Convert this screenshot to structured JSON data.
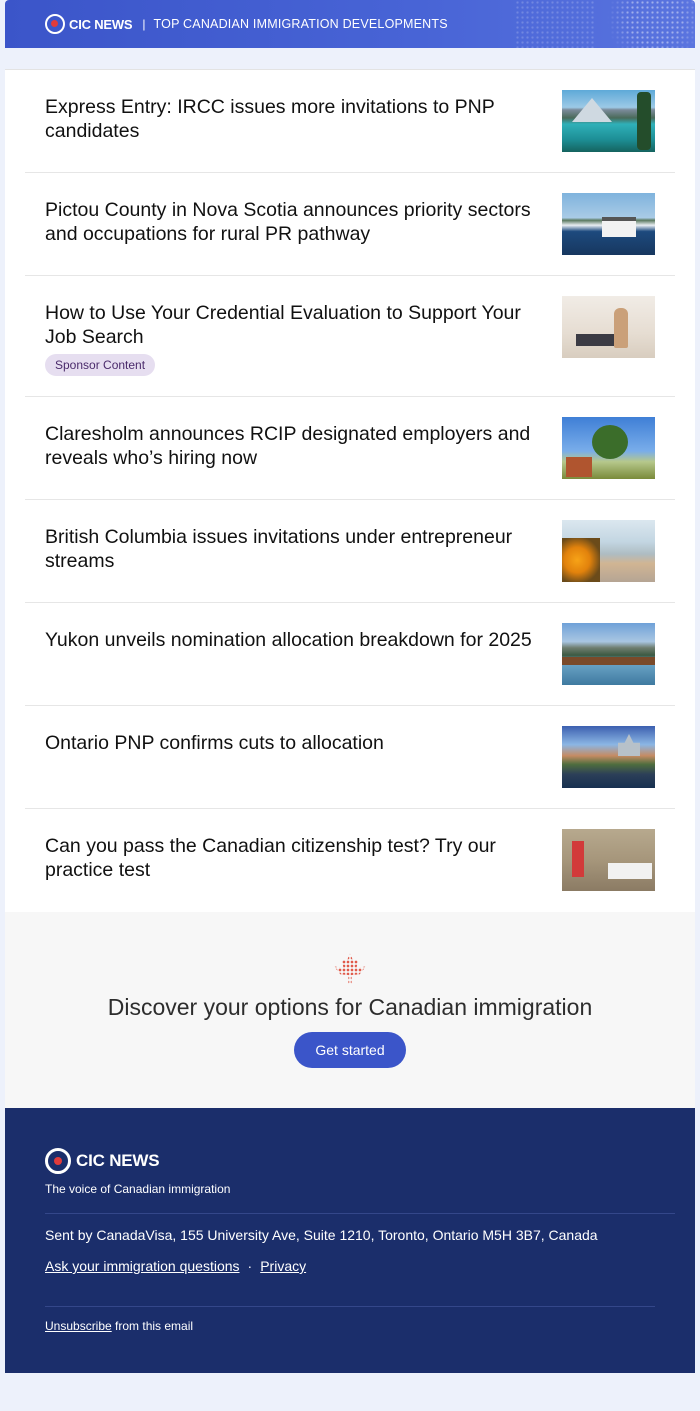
{
  "header": {
    "brand": "CIC NEWS",
    "separator": "|",
    "tagline": "TOP CANADIAN IMMIGRATION DEVELOPMENTS"
  },
  "articles": [
    {
      "title": "Express Entry: IRCC issues more invitations to PNP candidates",
      "badge": ""
    },
    {
      "title": "Pictou County in Nova Scotia announces priority sectors and occupations for rural PR pathway",
      "badge": ""
    },
    {
      "title": "How to Use Your Credential Evaluation to Support Your Job Search",
      "badge": "Sponsor Content"
    },
    {
      "title": "Claresholm announces RCIP designated employers and reveals who’s hiring now",
      "badge": ""
    },
    {
      "title": "British Columbia issues invitations under entrepreneur streams",
      "badge": ""
    },
    {
      "title": "Yukon unveils nomination allocation breakdown for 2025",
      "badge": ""
    },
    {
      "title": "Ontario PNP confirms cuts to allocation",
      "badge": ""
    },
    {
      "title": "Can you pass the Canadian citizenship test? Try our practice test",
      "badge": ""
    }
  ],
  "discover": {
    "title": "Discover your options for Canadian immigration",
    "cta": "Get started"
  },
  "footer": {
    "brand": "CIC NEWS",
    "tagline": "The voice of Canadian immigration",
    "sent_by": "Sent by CanadaVisa, 155 University Ave, Suite 1210, Toronto, Ontario M5H 3B7, Canada",
    "link_questions": "Ask your immigration questions",
    "link_separator": "·",
    "link_privacy": "Privacy",
    "unsubscribe": "Unsubscribe",
    "unsubscribe_suffix": " from this email"
  },
  "colors": {
    "brand_blue": "#3b55c9",
    "footer_navy": "#1b2e6b",
    "badge_bg": "#e6def0",
    "page_bg": "#edf1fb"
  },
  "icons": {
    "logo": "cic-logo-icon",
    "leaf": "maple-leaf-icon"
  }
}
